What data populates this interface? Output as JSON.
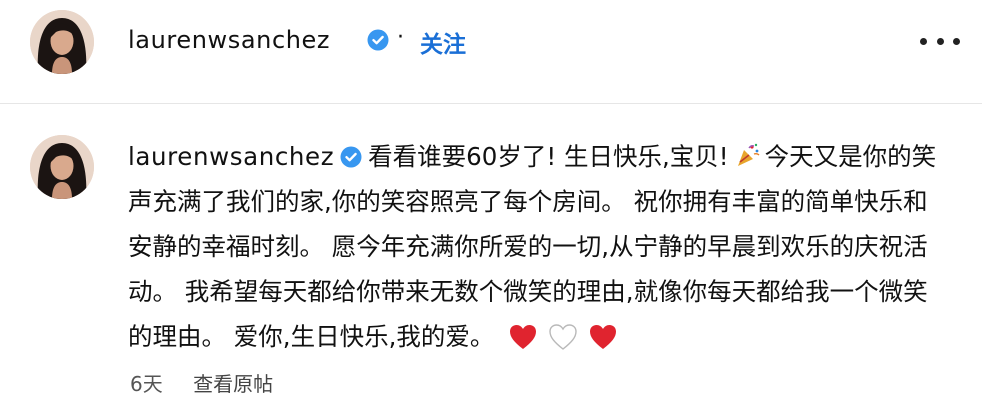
{
  "header": {
    "username": "laurenwsanchez",
    "separator": "·",
    "follow_label": "关注"
  },
  "comment": {
    "username": "laurenwsanchez",
    "text_part1": "看看谁要60岁了! 生日快乐,宝贝!",
    "text_part2": "今天又是你的笑声充满了我们的家,你的笑容照亮了每个房间。 祝你拥有丰富的简单快乐和安静的幸福时刻。 愿今年充满你所爱的一切,从宁静的早晨到欢乐的庆祝活动。 我希望每天都给你带来无数个微笑的理由,就像你每天都给我一个微笑的理由。 爱你,生日快乐,我的爱。",
    "emoji": [
      "party-popper-icon",
      "red-heart-icon",
      "white-heart-icon",
      "red-heart-icon"
    ],
    "time": "6天",
    "view_original_label": "查看原帖"
  },
  "colors": {
    "link_blue": "#1a6fd6",
    "verified_blue": "#3897f0",
    "heart_red": "#e0242f",
    "text": "#111111",
    "meta_gray": "#555555"
  }
}
